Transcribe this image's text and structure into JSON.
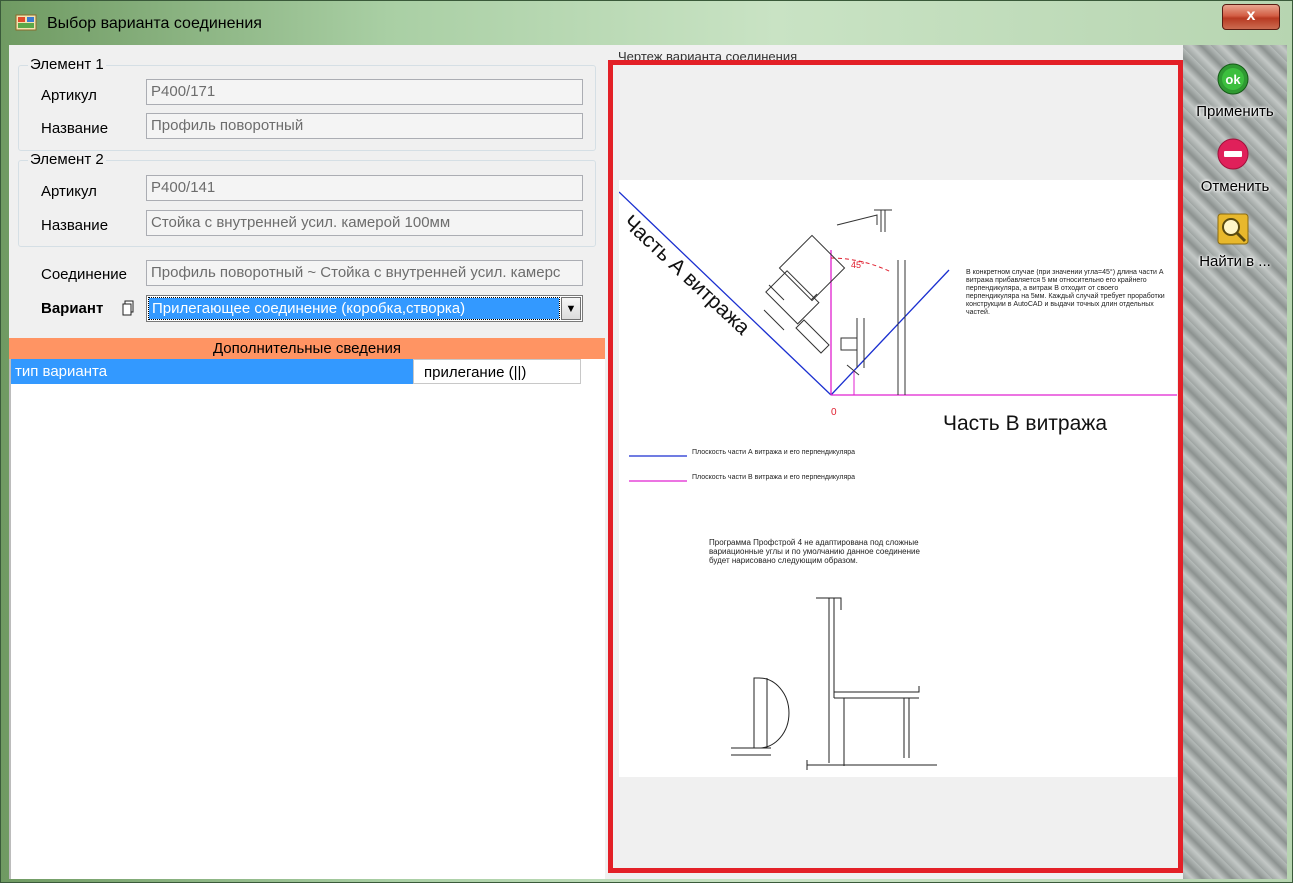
{
  "window": {
    "title": "Выбор варианта соединения",
    "close_label": "x"
  },
  "element1": {
    "title": "Элемент 1",
    "article_label": "Артикул",
    "article_value": "P400/171",
    "name_label": "Название",
    "name_value": "Профиль поворотный"
  },
  "element2": {
    "title": "Элемент 2",
    "article_label": "Артикул",
    "article_value": "P400/141",
    "name_label": "Название",
    "name_value": "Стойка с внутренней усил. камерой 100мм"
  },
  "connection": {
    "label": "Соединение",
    "value": "Профиль поворотный ~ Стойка с внутренней усил. камерс"
  },
  "variant": {
    "label": "Вариант",
    "selected": "Прилегающее соединение (коробка,створка)"
  },
  "extra_info": {
    "header": "Дополнительные сведения",
    "rows": [
      {
        "name": "тип варианта",
        "value": "прилегание (||)"
      }
    ]
  },
  "preview": {
    "caption": "Чертеж варианта соединения",
    "part_a": "Часть А витража",
    "part_b": "Часть В витража",
    "angle_label": "45°",
    "note_1": "В конкретном случае (при значении угла=45°) длина части А витража прибавляется 5 мм относительно его крайнего перпендикуляра, а витраж В отходит от своего перпендикуляра на 5мм. Каждый случай требует проработки конструкции в AutoCAD и выдачи точных длин отдельных частей.",
    "legend_blue": "Плоскость части А витража и его перпендикуляра",
    "legend_magenta": "Плоскость части В витража и его перпендикуляра",
    "note_2": "Программа Профстрой 4 не адаптирована под сложные вариационные углы и по умолчанию данное соединение будет нарисовано следующим образом."
  },
  "actions": [
    {
      "label": "Применить",
      "icon": "ok-icon"
    },
    {
      "label": "Отменить",
      "icon": "cancel-icon"
    },
    {
      "label": "Найти в ...",
      "icon": "find-icon"
    }
  ],
  "colors": {
    "accent": "#3399ff",
    "header": "#ff9463",
    "frame": "#e32027",
    "blue_line": "#1a2fd0",
    "magenta_line": "#e020d0"
  }
}
